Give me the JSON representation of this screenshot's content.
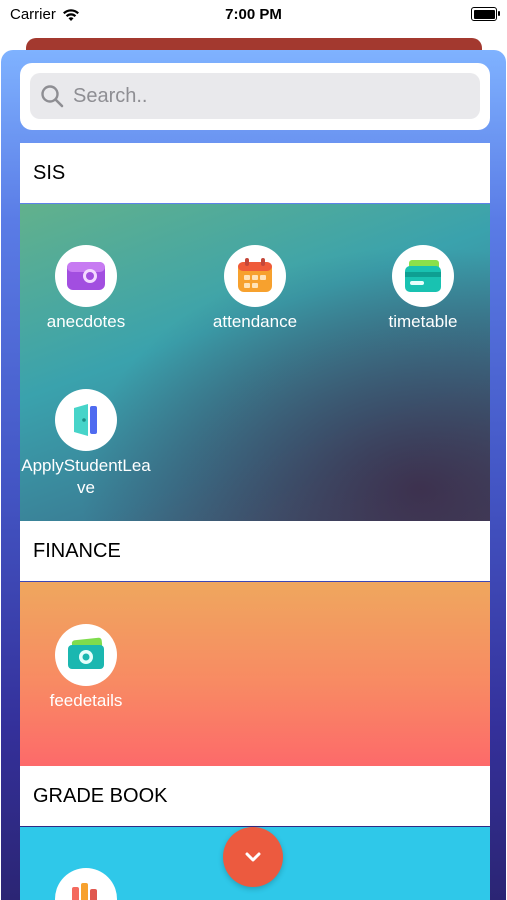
{
  "status_bar": {
    "carrier": "Carrier",
    "time": "7:00 PM"
  },
  "search": {
    "placeholder": "Search.."
  },
  "sections": {
    "sis": {
      "title": "SIS",
      "apps": [
        {
          "label": "anecdotes",
          "icon": "wallet-icon"
        },
        {
          "label": "attendance",
          "icon": "calendar-icon"
        },
        {
          "label": "timetable",
          "icon": "card-icon"
        },
        {
          "label": "ApplyStudentLeave",
          "icon": "exit-door-icon"
        }
      ]
    },
    "finance": {
      "title": "FINANCE",
      "apps": [
        {
          "label": "feedetails",
          "icon": "money-icon"
        }
      ]
    },
    "grade_book": {
      "title": "GRADE BOOK",
      "apps": [
        {
          "label": "",
          "icon": "books-icon"
        }
      ]
    }
  },
  "colors": {
    "sheet_top": "#7fb2ff",
    "sheet_bottom": "#2b2574",
    "finance_top": "#efa75e",
    "finance_bottom": "#fd6a6a",
    "grade_bg": "#2fc8e9",
    "fab": "#ec5a3f"
  }
}
